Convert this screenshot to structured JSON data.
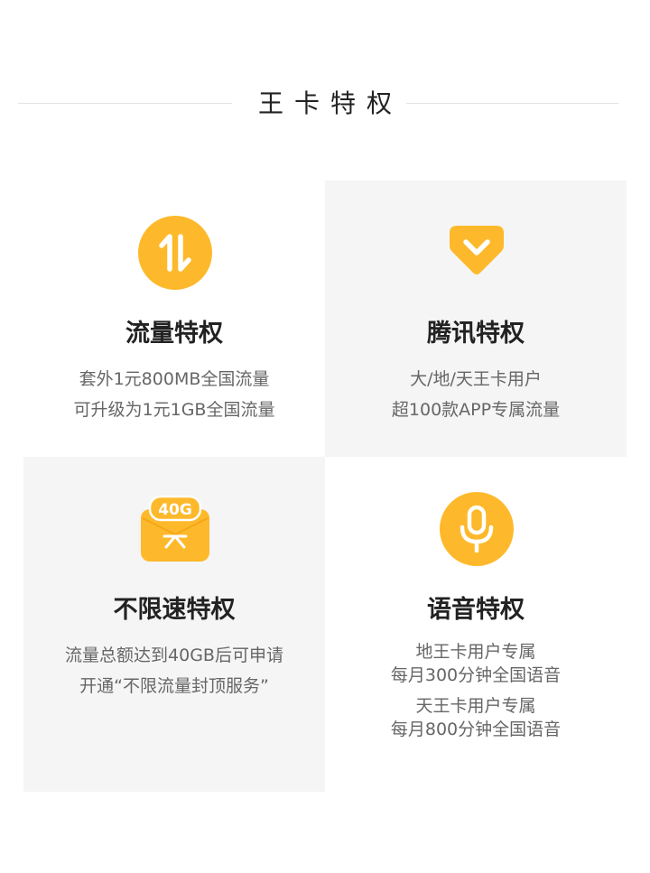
{
  "header": {
    "title": "王卡特权"
  },
  "colors": {
    "accent": "#FDB92B",
    "panel_gray": "#F5F5F5",
    "title_text": "#222222",
    "desc_text": "#666666"
  },
  "cards": [
    {
      "icon": "arrows-up-down-icon",
      "title": "流量特权",
      "lines": [
        "套外1元800MB全国流量",
        "可升级为1元1GB全国流量"
      ]
    },
    {
      "icon": "diamond-icon",
      "title": "腾讯特权",
      "lines": [
        "大/地/天王卡用户",
        "超100款APP专属流量"
      ]
    },
    {
      "icon": "40g-package-icon",
      "badge": "40G",
      "title": "不限速特权",
      "lines": [
        "流量总额达到40GB后可申请",
        "开通“不限流量封顶服务”"
      ]
    },
    {
      "icon": "microphone-icon",
      "title": "语音特权",
      "lines": [
        "地王卡用户专属",
        "每月300分钟全国语音",
        "天王卡用户专属",
        "每月800分钟全国语音"
      ]
    }
  ]
}
